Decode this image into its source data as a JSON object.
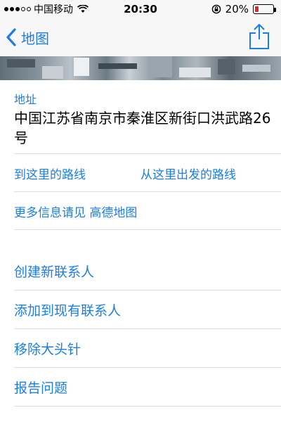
{
  "status_bar": {
    "signal_dots": 5,
    "signal_filled": 3,
    "carrier": "中国移动",
    "time": "20:30",
    "battery_percent": "20%",
    "battery_level": 0.2,
    "battery_color": "#e0262b"
  },
  "nav": {
    "back_label": "地图",
    "accent": "#1a7ee6"
  },
  "address": {
    "title": "地址",
    "value": "中国江苏省南京市秦淮区新街口洪武路26号"
  },
  "routes": {
    "to_here": "到这里的路线",
    "from_here": "从这里出发的路线"
  },
  "more_info": "更多信息请见 高德地图",
  "actions": [
    {
      "label": "创建新联系人"
    },
    {
      "label": "添加到现有联系人"
    },
    {
      "label": "移除大头针"
    },
    {
      "label": "报告问题"
    }
  ]
}
